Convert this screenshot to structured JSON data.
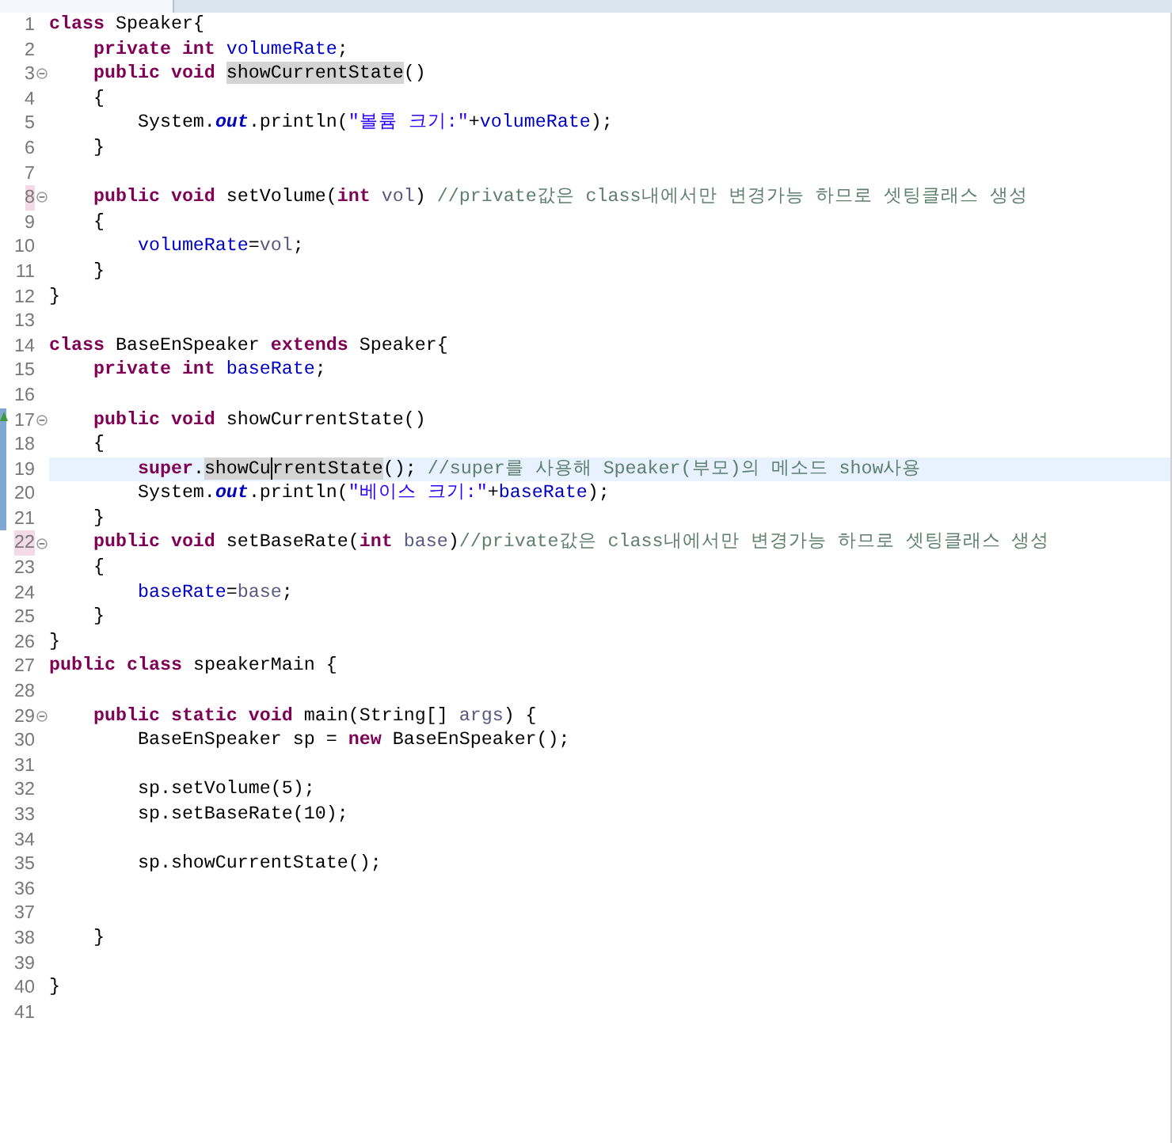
{
  "editor": {
    "lines": [
      {
        "number": "1",
        "fold": false,
        "marked": false,
        "current": false,
        "override": false,
        "changed": false,
        "tokens": [
          {
            "kind": "keyword",
            "text": "class"
          },
          {
            "kind": "plain",
            "text": " Speaker{"
          }
        ]
      },
      {
        "number": "2",
        "fold": false,
        "marked": false,
        "current": false,
        "override": false,
        "changed": false,
        "tokens": [
          {
            "kind": "keyword",
            "text": "    private int "
          },
          {
            "kind": "field",
            "text": "volumeRate"
          },
          {
            "kind": "plain",
            "text": ";"
          }
        ]
      },
      {
        "number": "3",
        "fold": true,
        "marked": false,
        "current": false,
        "override": false,
        "changed": false,
        "tokens": [
          {
            "kind": "keyword",
            "text": "    public void "
          },
          {
            "kind": "occurrence",
            "text": "showCurrentState"
          },
          {
            "kind": "plain",
            "text": "()"
          }
        ]
      },
      {
        "number": "4",
        "fold": false,
        "marked": false,
        "current": false,
        "override": false,
        "changed": false,
        "tokens": [
          {
            "kind": "plain",
            "text": "    {"
          }
        ]
      },
      {
        "number": "5",
        "fold": false,
        "marked": false,
        "current": false,
        "override": false,
        "changed": false,
        "tokens": [
          {
            "kind": "plain",
            "text": "        System."
          },
          {
            "kind": "static",
            "text": "out"
          },
          {
            "kind": "plain",
            "text": ".println("
          },
          {
            "kind": "string",
            "text": "\"볼륨 크기:\""
          },
          {
            "kind": "plain",
            "text": "+"
          },
          {
            "kind": "field",
            "text": "volumeRate"
          },
          {
            "kind": "plain",
            "text": ");"
          }
        ]
      },
      {
        "number": "6",
        "fold": false,
        "marked": false,
        "current": false,
        "override": false,
        "changed": false,
        "tokens": [
          {
            "kind": "plain",
            "text": "    }"
          }
        ]
      },
      {
        "number": "7",
        "fold": false,
        "marked": false,
        "current": false,
        "override": false,
        "changed": false
      },
      {
        "number": "8",
        "fold": true,
        "marked": true,
        "current": false,
        "override": false,
        "changed": false,
        "tokens": [
          {
            "kind": "keyword",
            "text": "    public void "
          },
          {
            "kind": "plain",
            "text": "setVolume("
          },
          {
            "kind": "keyword",
            "text": "int "
          },
          {
            "kind": "param",
            "text": "vol"
          },
          {
            "kind": "plain",
            "text": ") "
          },
          {
            "kind": "comment",
            "text": "//private값은 class내에서만 변경가능 하므로 셋팅클래스 생성"
          }
        ]
      },
      {
        "number": "9",
        "fold": false,
        "marked": false,
        "current": false,
        "override": false,
        "changed": false,
        "tokens": [
          {
            "kind": "plain",
            "text": "    {"
          }
        ]
      },
      {
        "number": "10",
        "fold": false,
        "marked": false,
        "current": false,
        "override": false,
        "changed": false,
        "tokens": [
          {
            "kind": "field",
            "text": "        volumeRate"
          },
          {
            "kind": "plain",
            "text": "="
          },
          {
            "kind": "param",
            "text": "vol"
          },
          {
            "kind": "plain",
            "text": ";"
          }
        ]
      },
      {
        "number": "11",
        "fold": false,
        "marked": false,
        "current": false,
        "override": false,
        "changed": false,
        "tokens": [
          {
            "kind": "plain",
            "text": "    }"
          }
        ]
      },
      {
        "number": "12",
        "fold": false,
        "marked": false,
        "current": false,
        "override": false,
        "changed": false,
        "tokens": [
          {
            "kind": "plain",
            "text": "}"
          }
        ]
      },
      {
        "number": "13",
        "fold": false,
        "marked": false,
        "current": false,
        "override": false,
        "changed": false
      },
      {
        "number": "14",
        "fold": false,
        "marked": false,
        "current": false,
        "override": false,
        "changed": false,
        "tokens": [
          {
            "kind": "keyword",
            "text": "class"
          },
          {
            "kind": "plain",
            "text": " BaseEnSpeaker "
          },
          {
            "kind": "keyword",
            "text": "extends"
          },
          {
            "kind": "plain",
            "text": " Speaker{"
          }
        ]
      },
      {
        "number": "15",
        "fold": false,
        "marked": false,
        "current": false,
        "override": false,
        "changed": false,
        "tokens": [
          {
            "kind": "keyword",
            "text": "    private int "
          },
          {
            "kind": "field",
            "text": "baseRate"
          },
          {
            "kind": "plain",
            "text": ";"
          }
        ]
      },
      {
        "number": "16",
        "fold": false,
        "marked": false,
        "current": false,
        "override": false,
        "changed": false
      },
      {
        "number": "17",
        "fold": true,
        "marked": false,
        "current": false,
        "override": true,
        "changed": true,
        "tokens": [
          {
            "kind": "keyword",
            "text": "    public void "
          },
          {
            "kind": "plain",
            "text": "showCurrentState()"
          }
        ]
      },
      {
        "number": "18",
        "fold": false,
        "marked": false,
        "current": false,
        "override": false,
        "changed": true,
        "tokens": [
          {
            "kind": "plain",
            "text": "    {"
          }
        ]
      },
      {
        "number": "19",
        "fold": false,
        "marked": false,
        "current": true,
        "override": false,
        "changed": true,
        "tokens": [
          {
            "kind": "keyword",
            "text": "        super"
          },
          {
            "kind": "plain",
            "text": "."
          },
          {
            "kind": "occurrence_caret",
            "text": "showCu"
          },
          {
            "kind": "occurrence",
            "text": "rrentState"
          },
          {
            "kind": "plain",
            "text": "(); "
          },
          {
            "kind": "comment",
            "text": "//super를 사용해 Speaker(부모)의 메소드 show사용"
          }
        ]
      },
      {
        "number": "20",
        "fold": false,
        "marked": false,
        "current": false,
        "override": false,
        "changed": true,
        "tokens": [
          {
            "kind": "plain",
            "text": "        System."
          },
          {
            "kind": "static",
            "text": "out"
          },
          {
            "kind": "plain",
            "text": ".println("
          },
          {
            "kind": "string",
            "text": "\"베이스 크기:\""
          },
          {
            "kind": "plain",
            "text": "+"
          },
          {
            "kind": "field",
            "text": "baseRate"
          },
          {
            "kind": "plain",
            "text": ");"
          }
        ]
      },
      {
        "number": "21",
        "fold": false,
        "marked": false,
        "current": false,
        "override": false,
        "changed": true,
        "tokens": [
          {
            "kind": "plain",
            "text": "    }"
          }
        ]
      },
      {
        "number": "22",
        "fold": true,
        "marked": true,
        "current": false,
        "override": false,
        "changed": false,
        "tokens": [
          {
            "kind": "keyword",
            "text": "    public void "
          },
          {
            "kind": "plain",
            "text": "setBaseRate("
          },
          {
            "kind": "keyword",
            "text": "int "
          },
          {
            "kind": "param",
            "text": "base"
          },
          {
            "kind": "plain",
            "text": ")"
          },
          {
            "kind": "comment",
            "text": "//private값은 class내에서만 변경가능 하므로 셋팅클래스 생성"
          }
        ]
      },
      {
        "number": "23",
        "fold": false,
        "marked": false,
        "current": false,
        "override": false,
        "changed": false,
        "tokens": [
          {
            "kind": "plain",
            "text": "    {"
          }
        ]
      },
      {
        "number": "24",
        "fold": false,
        "marked": false,
        "current": false,
        "override": false,
        "changed": false,
        "tokens": [
          {
            "kind": "field",
            "text": "        baseRate"
          },
          {
            "kind": "plain",
            "text": "="
          },
          {
            "kind": "param",
            "text": "base"
          },
          {
            "kind": "plain",
            "text": ";"
          }
        ]
      },
      {
        "number": "25",
        "fold": false,
        "marked": false,
        "current": false,
        "override": false,
        "changed": false,
        "tokens": [
          {
            "kind": "plain",
            "text": "    }"
          }
        ]
      },
      {
        "number": "26",
        "fold": false,
        "marked": false,
        "current": false,
        "override": false,
        "changed": false,
        "tokens": [
          {
            "kind": "plain",
            "text": "}"
          }
        ]
      },
      {
        "number": "27",
        "fold": false,
        "marked": false,
        "current": false,
        "override": false,
        "changed": false,
        "tokens": [
          {
            "kind": "keyword",
            "text": "public class"
          },
          {
            "kind": "plain",
            "text": " speakerMain {"
          }
        ]
      },
      {
        "number": "28",
        "fold": false,
        "marked": false,
        "current": false,
        "override": false,
        "changed": false
      },
      {
        "number": "29",
        "fold": true,
        "marked": false,
        "current": false,
        "override": false,
        "changed": false,
        "tokens": [
          {
            "kind": "keyword",
            "text": "    public static void "
          },
          {
            "kind": "plain",
            "text": "main(String[] "
          },
          {
            "kind": "param",
            "text": "args"
          },
          {
            "kind": "plain",
            "text": ") {"
          }
        ]
      },
      {
        "number": "30",
        "fold": false,
        "marked": false,
        "current": false,
        "override": false,
        "changed": false,
        "tokens": [
          {
            "kind": "plain",
            "text": "        BaseEnSpeaker sp = "
          },
          {
            "kind": "keyword",
            "text": "new"
          },
          {
            "kind": "plain",
            "text": " BaseEnSpeaker();"
          }
        ]
      },
      {
        "number": "31",
        "fold": false,
        "marked": false,
        "current": false,
        "override": false,
        "changed": false
      },
      {
        "number": "32",
        "fold": false,
        "marked": false,
        "current": false,
        "override": false,
        "changed": false,
        "tokens": [
          {
            "kind": "plain",
            "text": "        sp.setVolume(5);"
          }
        ]
      },
      {
        "number": "33",
        "fold": false,
        "marked": false,
        "current": false,
        "override": false,
        "changed": false,
        "tokens": [
          {
            "kind": "plain",
            "text": "        sp.setBaseRate(10);"
          }
        ]
      },
      {
        "number": "34",
        "fold": false,
        "marked": false,
        "current": false,
        "override": false,
        "changed": false
      },
      {
        "number": "35",
        "fold": false,
        "marked": false,
        "current": false,
        "override": false,
        "changed": false,
        "tokens": [
          {
            "kind": "plain",
            "text": "        sp.showCurrentState();"
          }
        ]
      },
      {
        "number": "36",
        "fold": false,
        "marked": false,
        "current": false,
        "override": false,
        "changed": false
      },
      {
        "number": "37",
        "fold": false,
        "marked": false,
        "current": false,
        "override": false,
        "changed": false
      },
      {
        "number": "38",
        "fold": false,
        "marked": false,
        "current": false,
        "override": false,
        "changed": false,
        "tokens": [
          {
            "kind": "plain",
            "text": "    }"
          }
        ]
      },
      {
        "number": "39",
        "fold": false,
        "marked": false,
        "current": false,
        "override": false,
        "changed": false
      },
      {
        "number": "40",
        "fold": false,
        "marked": false,
        "current": false,
        "override": false,
        "changed": false,
        "tokens": [
          {
            "kind": "plain",
            "text": "}"
          }
        ]
      },
      {
        "number": "41",
        "fold": false,
        "marked": false,
        "current": false,
        "override": false,
        "changed": false
      }
    ]
  }
}
